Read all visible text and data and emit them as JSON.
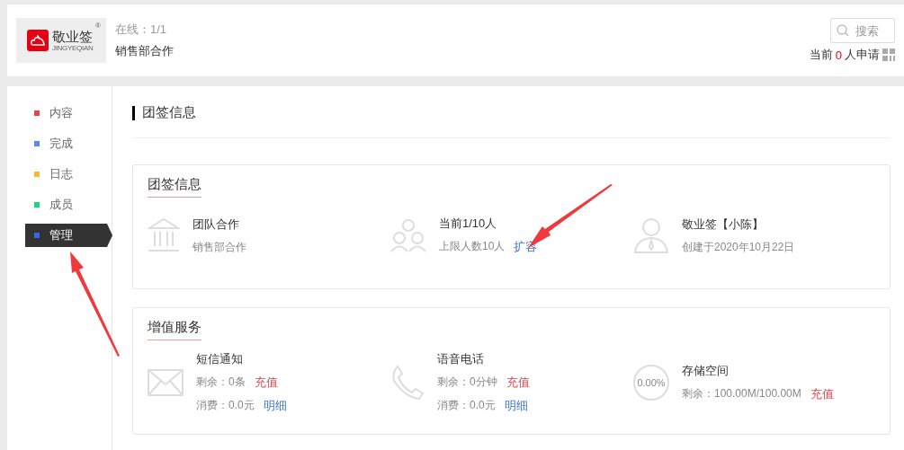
{
  "header": {
    "logo": {
      "name": "敬业签",
      "sub": "JINGYEQIAN",
      "mark": "®"
    },
    "online": "在线：1/1",
    "team": "销售部合作",
    "search": {
      "placeholder": "搜索"
    },
    "applicants": {
      "prefix": "当前",
      "count": "0",
      "suffix": "人申请"
    }
  },
  "sidebar": {
    "items": [
      {
        "label": "内容",
        "color": "#e8434b",
        "selected": false
      },
      {
        "label": "完成",
        "color": "#5b86f5",
        "selected": false
      },
      {
        "label": "日志",
        "color": "#fbb72d",
        "selected": false
      },
      {
        "label": "成员",
        "color": "#1ed47f",
        "selected": false
      },
      {
        "label": "管理",
        "color": "#3a64e0",
        "selected": true
      }
    ]
  },
  "page_title": "团签信息",
  "cards": [
    {
      "title": "团签信息",
      "items": [
        {
          "kind": "building",
          "title": "团队合作",
          "lines": [
            {
              "text": "销售部合作"
            }
          ]
        },
        {
          "kind": "people",
          "title": "当前1/10人",
          "lines": [
            {
              "text": "上限人数10人",
              "link": {
                "text": "扩容",
                "kind": "blue"
              }
            }
          ]
        },
        {
          "kind": "person",
          "title": "敬业签【小陈】",
          "lines": [
            {
              "text": "创建于2020年10月22日"
            }
          ]
        }
      ]
    },
    {
      "title": "增值服务",
      "items": [
        {
          "kind": "envelope",
          "title": "短信通知",
          "lines": [
            {
              "text": "剩余：0条",
              "link": {
                "text": "充值",
                "kind": "red"
              }
            },
            {
              "text": "消费：0.0元",
              "link": {
                "text": "明细",
                "kind": "blue"
              }
            }
          ]
        },
        {
          "kind": "phone",
          "title": "语音电话",
          "lines": [
            {
              "text": "剩余：0分钟",
              "link": {
                "text": "充值",
                "kind": "red"
              }
            },
            {
              "text": "消费：0.0元",
              "link": {
                "text": "明细",
                "kind": "blue"
              }
            }
          ]
        },
        {
          "kind": "ring",
          "ring_text": "0.00%",
          "title": "存储空间",
          "lines": [
            {
              "text": "剩余：100.00M/100.00M",
              "link": {
                "text": "充值",
                "kind": "red"
              }
            }
          ]
        }
      ]
    }
  ]
}
